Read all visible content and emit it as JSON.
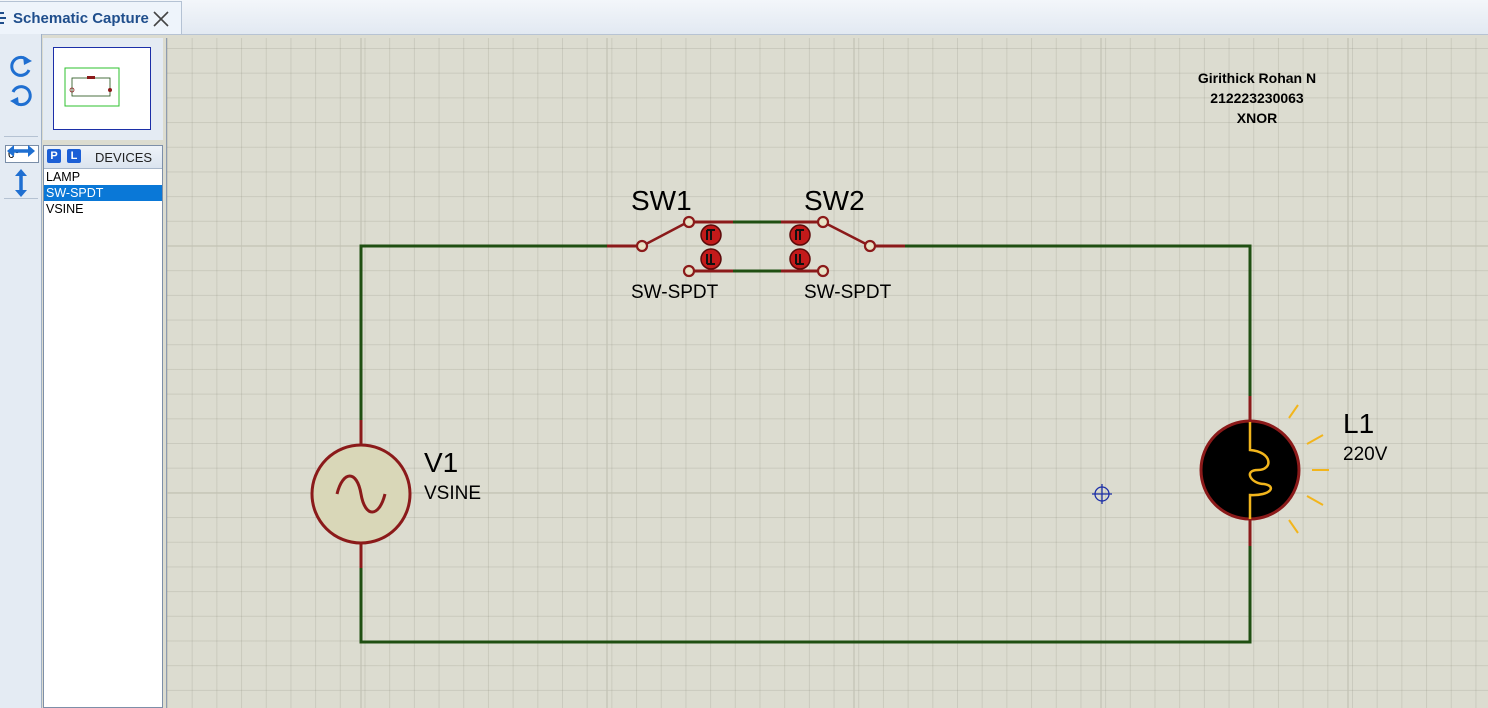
{
  "tab": {
    "title": "Schematic Capture",
    "close": "close-tab"
  },
  "toolbar": {
    "angle": "0°"
  },
  "devices": {
    "p_label": "P",
    "l_label": "L",
    "title": "DEVICES",
    "items": [
      {
        "label": "LAMP",
        "selected": false
      },
      {
        "label": "SW-SPDT",
        "selected": true
      },
      {
        "label": "VSINE",
        "selected": false
      }
    ]
  },
  "annotation": {
    "name": "Girithick Rohan N",
    "id": "212223230063",
    "gate": "XNOR"
  },
  "components": {
    "sw1": {
      "ref": "SW1",
      "type": "SW-SPDT"
    },
    "sw2": {
      "ref": "SW2",
      "type": "SW-SPDT"
    },
    "v1": {
      "ref": "V1",
      "type": "VSINE"
    },
    "l1": {
      "ref": "L1",
      "value": "220V"
    }
  },
  "colors": {
    "wire": "#1f4f12",
    "component": "#8b1a1a",
    "lamp_glow": "#f2b51c",
    "selection": "#0a78d7"
  }
}
